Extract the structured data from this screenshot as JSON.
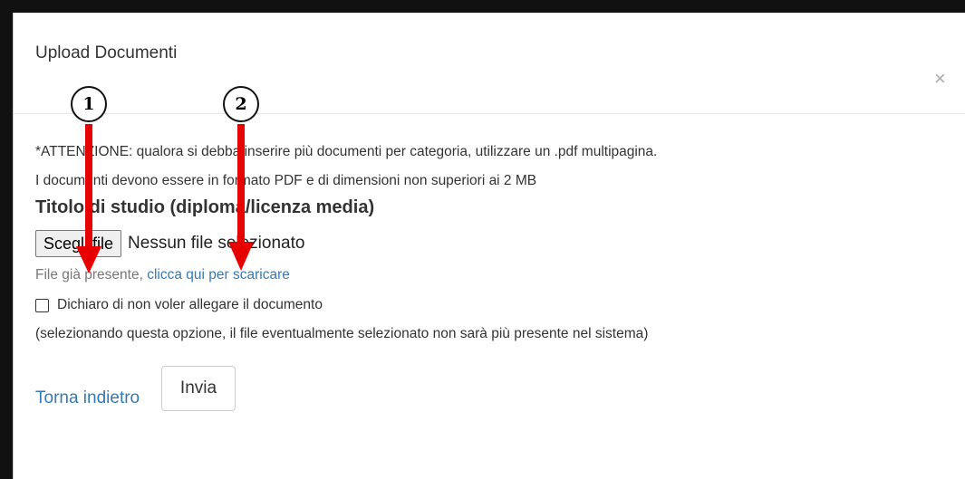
{
  "modal": {
    "title": "Upload Documenti",
    "close_glyph": "×",
    "notice_line1": "*ATTENZIONE: qualora si debba inserire più documenti per categoria, utilizzare un .pdf multipagina.",
    "notice_line2": "I documenti devono essere in formato PDF e di dimensioni non superiori ai 2 MB",
    "section_title": "Titolo di studio (diploma/licenza media)",
    "file_button_label": "Scegli file",
    "file_status": "Nessun file selezionato",
    "existing_text": "File già presente, ",
    "download_link": "clicca qui per scaricare",
    "checkbox_label": "Dichiaro di non voler allegare il documento",
    "checkbox_note": "(selezionando questa opzione, il file eventualmente selezionato non sarà più presente nel sistema)",
    "back_link": "Torna indietro",
    "submit_label": "Invia"
  },
  "annotations": {
    "marker1": "1",
    "marker2": "2",
    "arrow_color": "#e60000"
  }
}
